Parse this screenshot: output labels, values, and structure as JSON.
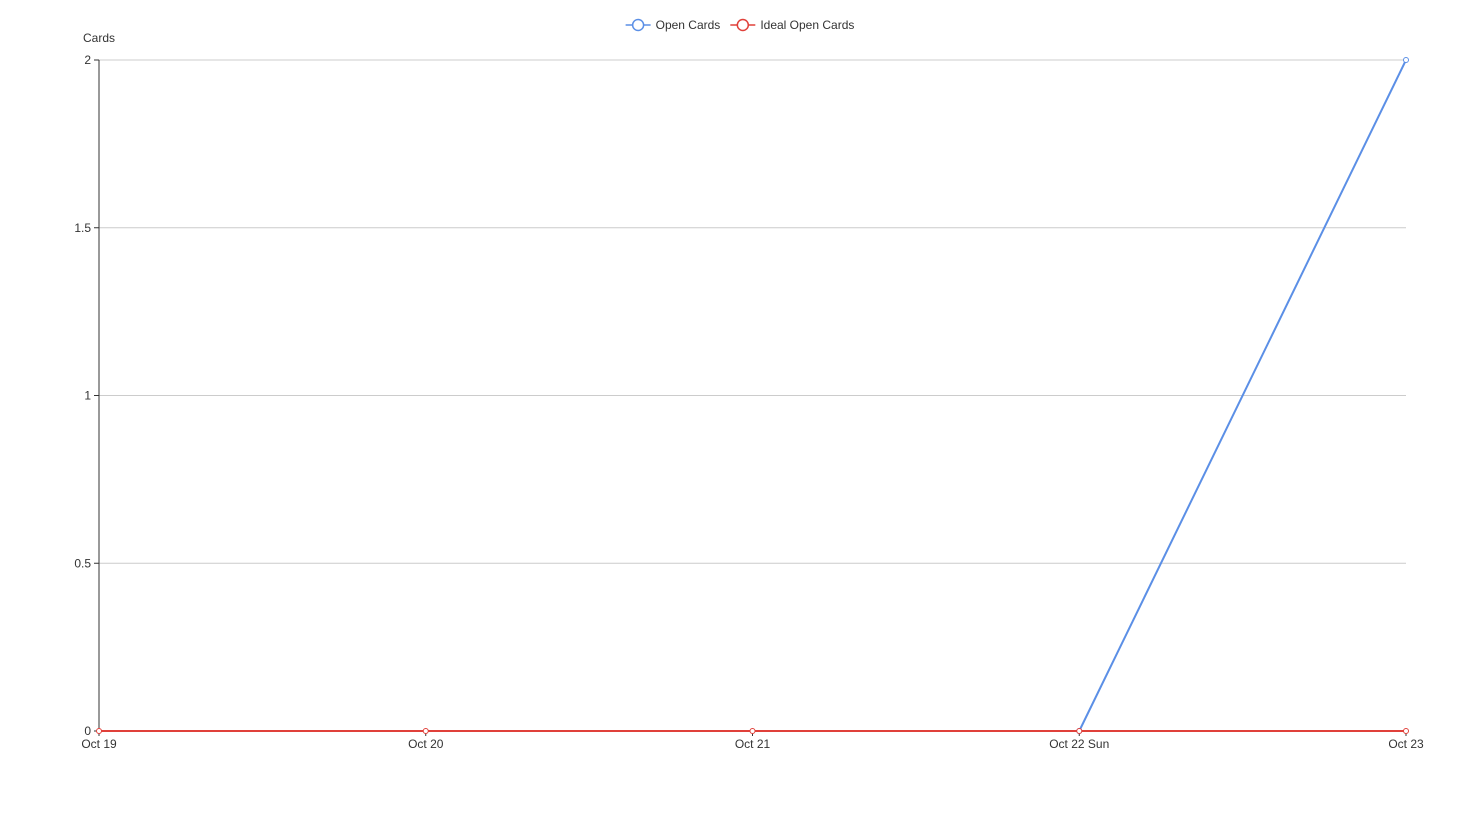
{
  "chart_data": {
    "type": "line",
    "ylabel": "Cards",
    "x": [
      "Oct 19",
      "Oct 20",
      "Oct 21",
      "Oct 22 Sun",
      "Oct 23"
    ],
    "ylim": [
      0,
      2
    ],
    "yticks": [
      0,
      0.5,
      1,
      1.5,
      2
    ],
    "ytick_labels": [
      "0",
      "0.5",
      "1",
      "1.5",
      "2"
    ],
    "grid": true,
    "legend_position": "top-center",
    "series": [
      {
        "name": "Open Cards",
        "color": "#5b8fe6",
        "values": [
          null,
          null,
          null,
          0,
          2
        ]
      },
      {
        "name": "Ideal Open Cards",
        "color": "#e0403a",
        "values": [
          0,
          0,
          0,
          0,
          0
        ]
      }
    ]
  }
}
